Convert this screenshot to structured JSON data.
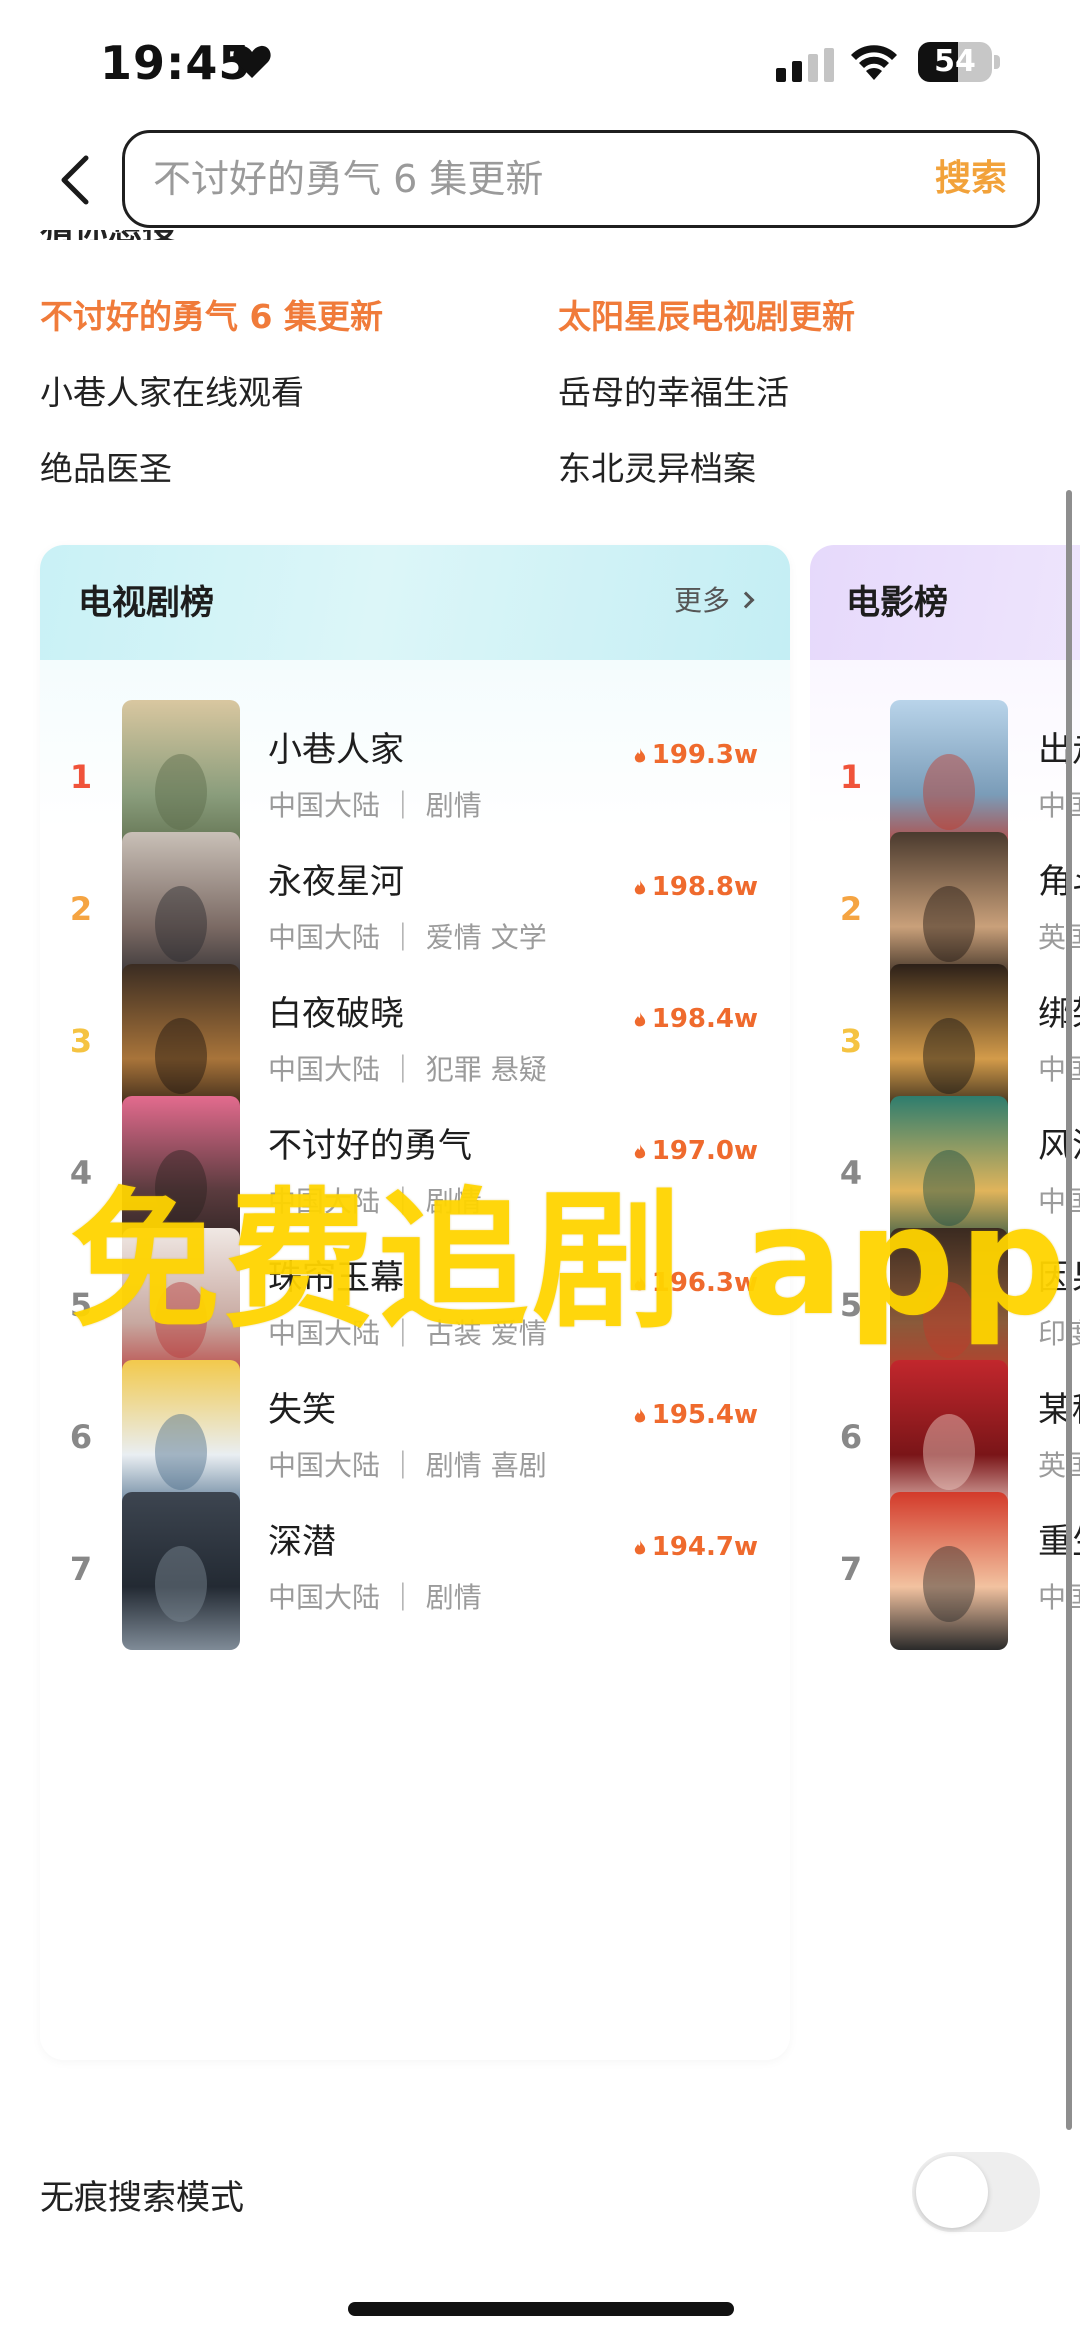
{
  "status_bar": {
    "time": "19:45",
    "battery": "54",
    "battery_level": 0.54
  },
  "search": {
    "placeholder": "不讨好的勇气 6 集更新",
    "button_label": "搜索"
  },
  "guess": {
    "title": "猜你想搜",
    "items": [
      {
        "label": "不讨好的勇气 6 集更新",
        "highlight": true
      },
      {
        "label": "太阳星辰电视剧更新",
        "highlight": true
      },
      {
        "label": "小巷人家在线观看",
        "highlight": false
      },
      {
        "label": "岳母的幸福生活",
        "highlight": false
      },
      {
        "label": "绝品医圣",
        "highlight": false
      },
      {
        "label": "东北灵异档案",
        "highlight": false
      }
    ]
  },
  "tv_ranking": {
    "title": "电视剧榜",
    "more": "更多",
    "items": [
      {
        "rank": "1",
        "title": "小巷人家",
        "meta": "中国大陆 ｜ 剧情",
        "score": "199.3w"
      },
      {
        "rank": "2",
        "title": "永夜星河",
        "meta": "中国大陆 ｜ 爱情 文学",
        "score": "198.8w"
      },
      {
        "rank": "3",
        "title": "白夜破晓",
        "meta": "中国大陆 ｜ 犯罪 悬疑",
        "score": "198.4w"
      },
      {
        "rank": "4",
        "title": "不讨好的勇气",
        "meta": "中国大陆 ｜ 剧情",
        "score": "197.0w"
      },
      {
        "rank": "5",
        "title": "珠帘玉幕",
        "meta": "中国大陆 ｜ 古装 爱情",
        "score": "196.3w"
      },
      {
        "rank": "6",
        "title": "失笑",
        "meta": "中国大陆 ｜ 剧情 喜剧",
        "score": "195.4w"
      },
      {
        "rank": "7",
        "title": "深潜",
        "meta": "中国大陆 ｜ 剧情",
        "score": "194.7w"
      }
    ]
  },
  "movie_ranking": {
    "title": "电影榜",
    "items": [
      {
        "rank": "1",
        "title": "出走",
        "meta": "中国"
      },
      {
        "rank": "2",
        "title": "角斗",
        "meta": "英国"
      },
      {
        "rank": "3",
        "title": "绑架",
        "meta": "中国"
      },
      {
        "rank": "4",
        "title": "风流",
        "meta": "中国"
      },
      {
        "rank": "5",
        "title": "因果",
        "meta": "印度"
      },
      {
        "rank": "6",
        "title": "某种",
        "meta": "英国"
      },
      {
        "rank": "7",
        "title": "重生",
        "meta": "中国"
      }
    ]
  },
  "watermark": "免费追剧 app",
  "incognito": {
    "label": "无痕搜索模式",
    "enabled": false
  },
  "colors": {
    "accent_orange": "#f07b3a",
    "search_button": "#f2a23a",
    "tv_header": "#c9f1f6",
    "movie_header": "#e6d9fb",
    "watermark": "#ffd400"
  }
}
